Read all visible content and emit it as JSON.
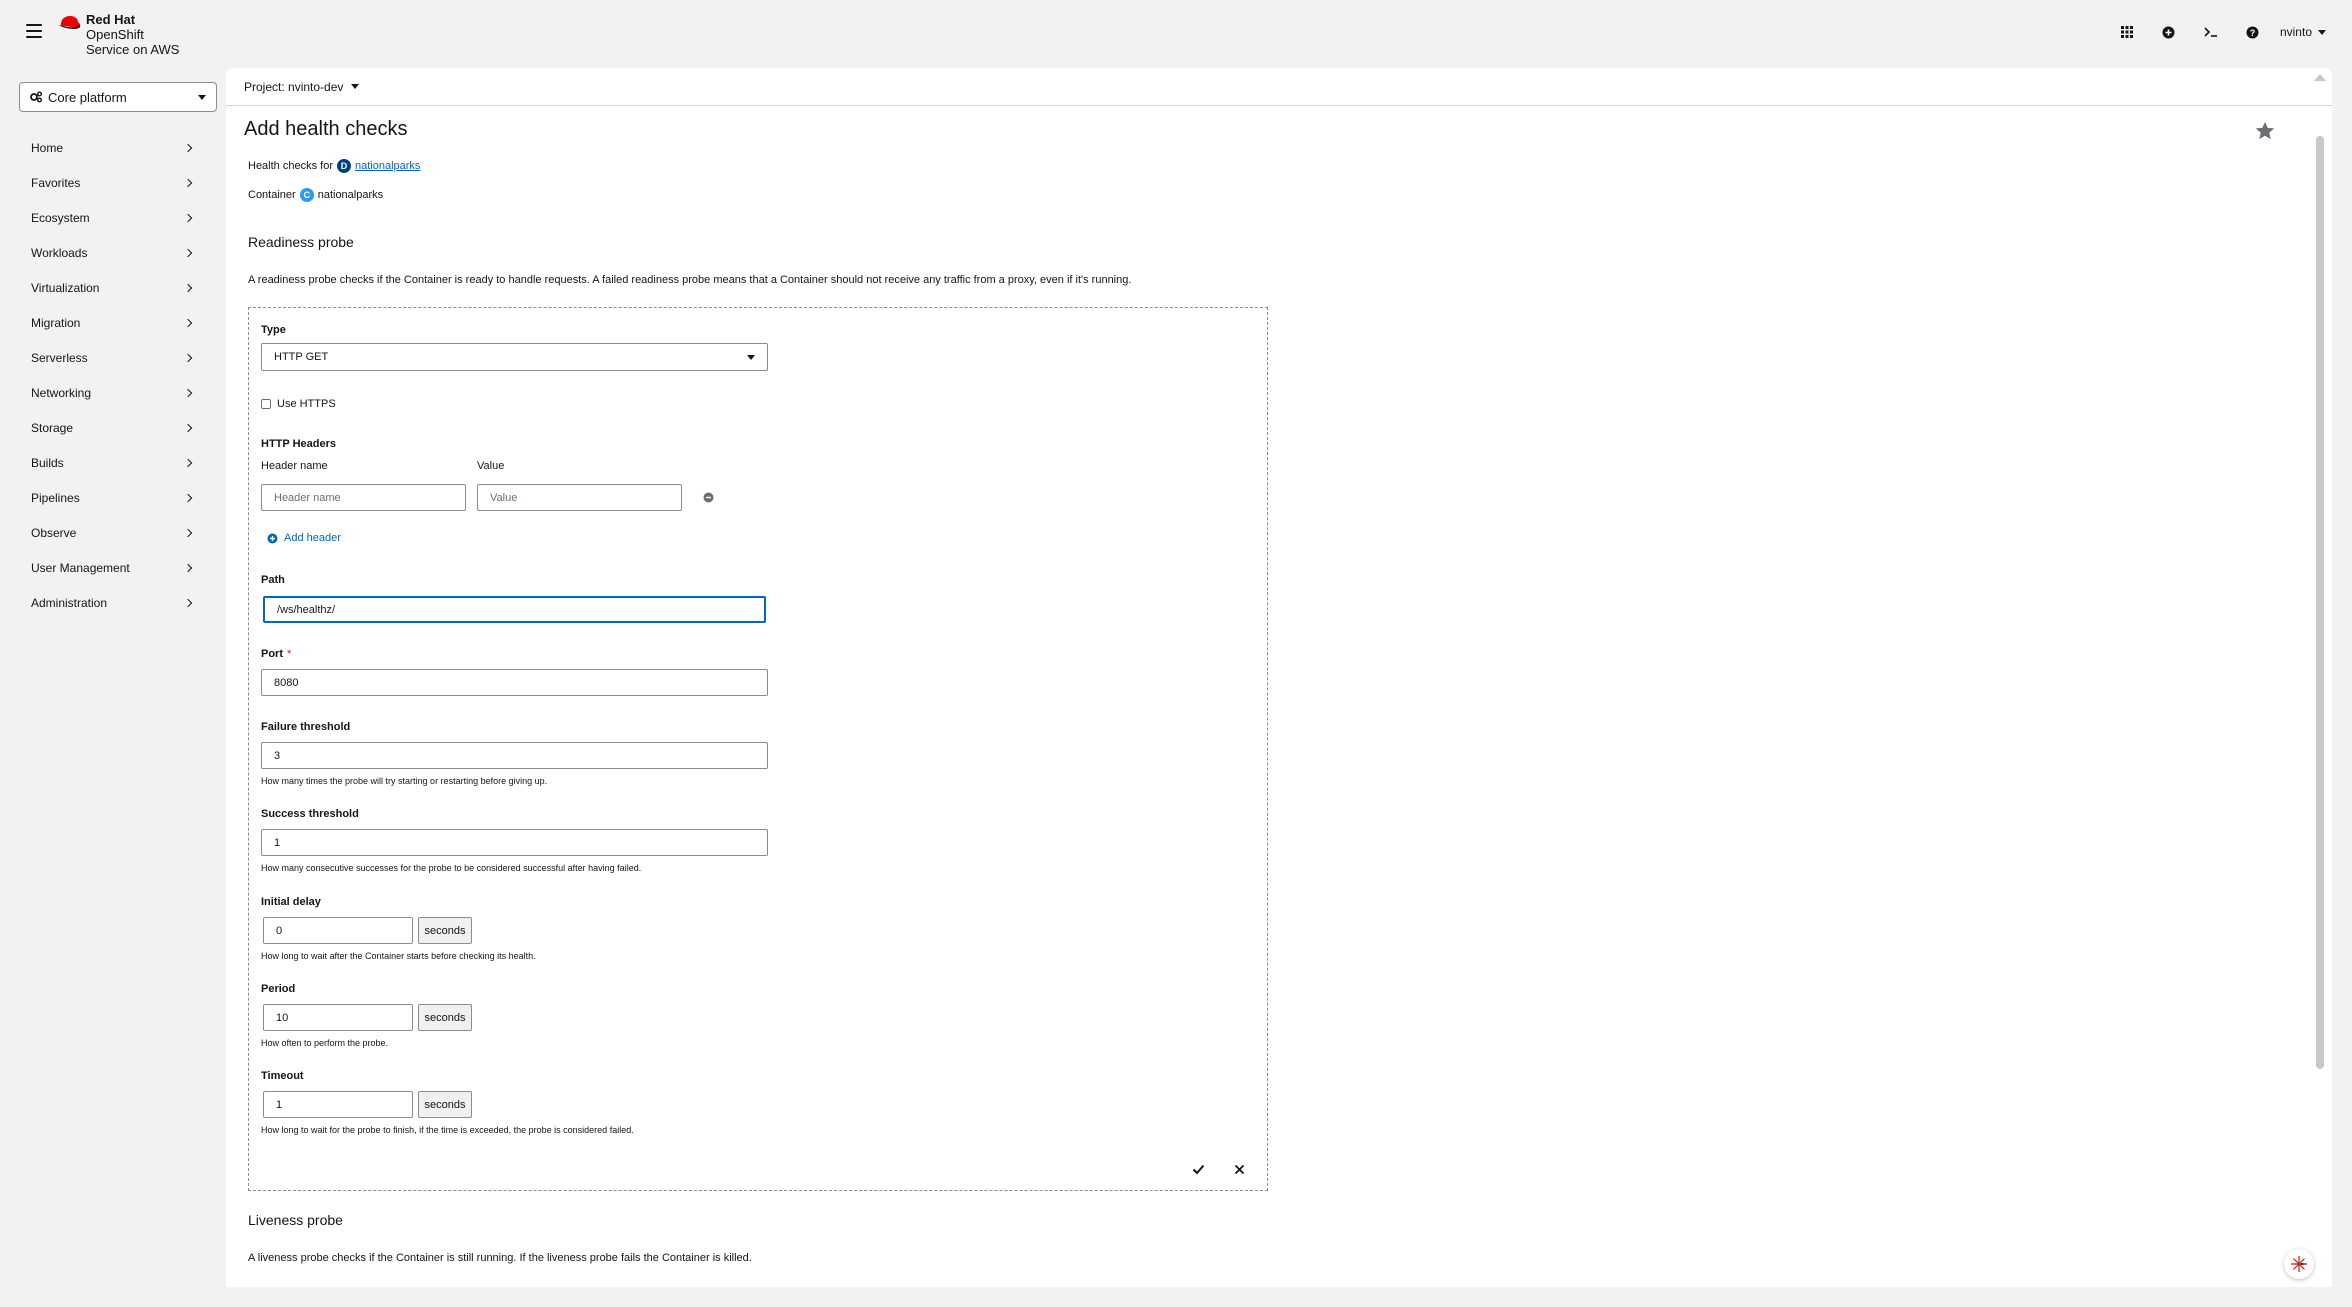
{
  "brand": {
    "line1": "Red Hat",
    "line2": "OpenShift",
    "line3": "Service on AWS"
  },
  "masthead": {
    "user": "nvinto"
  },
  "sidebar": {
    "perspective": "Core platform",
    "items": [
      {
        "label": "Home"
      },
      {
        "label": "Favorites"
      },
      {
        "label": "Ecosystem"
      },
      {
        "label": "Workloads"
      },
      {
        "label": "Virtualization"
      },
      {
        "label": "Migration"
      },
      {
        "label": "Serverless"
      },
      {
        "label": "Networking"
      },
      {
        "label": "Storage"
      },
      {
        "label": "Builds"
      },
      {
        "label": "Pipelines"
      },
      {
        "label": "Observe"
      },
      {
        "label": "User Management"
      },
      {
        "label": "Administration"
      }
    ]
  },
  "project_bar": {
    "label": "Project: nvinto-dev"
  },
  "page": {
    "title": "Add health checks",
    "health_checks_for": "Health checks for",
    "deployment_badge": "D",
    "deployment_name": "nationalparks",
    "container_label": "Container",
    "container_badge": "C",
    "container_name": "nationalparks"
  },
  "readiness": {
    "title": "Readiness probe",
    "description": "A readiness probe checks if the Container is ready to handle requests. A failed readiness probe means that a Container should not receive any traffic from a proxy, even if it's running.",
    "type_label": "Type",
    "type_value": "HTTP GET",
    "use_https": "Use HTTPS",
    "http_headers": "HTTP Headers",
    "header_name_label": "Header name",
    "value_label": "Value",
    "header_name_placeholder": "Header name",
    "value_placeholder": "Value",
    "add_header": "Add header",
    "path_label": "Path",
    "path_value": "/ws/healthz/",
    "port_label": "Port",
    "port_required": "*",
    "port_value": "8080",
    "failure_label": "Failure threshold",
    "failure_value": "3",
    "failure_help": "How many times the probe will try starting or restarting before giving up.",
    "success_label": "Success threshold",
    "success_value": "1",
    "success_help": "How many consecutive successes for the probe to be considered successful after having failed.",
    "initial_label": "Initial delay",
    "initial_value": "0",
    "initial_help": "How long to wait after the Container starts before checking its health.",
    "period_label": "Period",
    "period_value": "10",
    "period_help": "How often to perform the probe.",
    "timeout_label": "Timeout",
    "timeout_value": "1",
    "timeout_help": "How long to wait for the probe to finish, if the time is exceeded, the probe is considered failed.",
    "unit": "seconds"
  },
  "liveness": {
    "title": "Liveness probe",
    "description": "A liveness probe checks if the Container is still running. If the liveness probe fails the Container is killed."
  },
  "colors": {
    "brand_red": "#ee0000",
    "link": "#0066cc",
    "deployment_badge": "#004080",
    "container_badge": "#2b9af3"
  }
}
